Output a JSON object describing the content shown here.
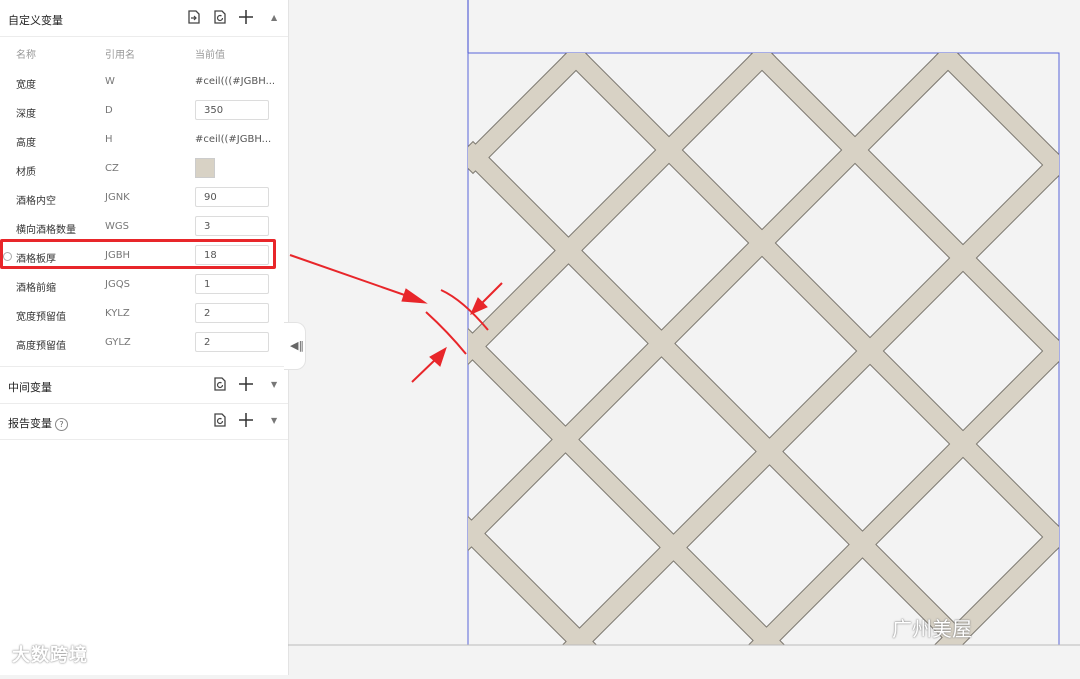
{
  "panel": {
    "custom_section": {
      "title": "自定义变量",
      "columns": {
        "name": "名称",
        "ref": "引用名",
        "value": "当前值"
      },
      "rows": [
        {
          "name": "宽度",
          "ref": "W",
          "value": "#ceil(((#JGBH...",
          "kind": "text"
        },
        {
          "name": "深度",
          "ref": "D",
          "value": "350",
          "kind": "input"
        },
        {
          "name": "高度",
          "ref": "H",
          "value": "#ceil((#JGBH...",
          "kind": "text"
        },
        {
          "name": "材质",
          "ref": "CZ",
          "value": "",
          "kind": "swatch",
          "color": "#d8d2c5"
        },
        {
          "name": "酒格内空",
          "ref": "JGNK",
          "value": "90",
          "kind": "input"
        },
        {
          "name": "横向酒格数量",
          "ref": "WGS",
          "value": "3",
          "kind": "input"
        },
        {
          "name": "酒格板厚",
          "ref": "JGBH",
          "value": "18",
          "kind": "input",
          "highlighted": true
        },
        {
          "name": "酒格前缩",
          "ref": "JGQS",
          "value": "1",
          "kind": "input"
        },
        {
          "name": "宽度预留值",
          "ref": "KYLZ",
          "value": "2",
          "kind": "input"
        },
        {
          "name": "高度预留值",
          "ref": "GYLZ",
          "value": "2",
          "kind": "input"
        }
      ]
    },
    "middle_section": {
      "title": "中间变量"
    },
    "report_section": {
      "title": "报告变量",
      "help": "?"
    }
  },
  "colors": {
    "highlight_red": "#e8262a",
    "panel_line": "#5a64d8",
    "wood": "#d8d2c5",
    "wood_edge": "#7a766e"
  },
  "watermarks": {
    "left": "大数跨境",
    "right": "广州美屋"
  }
}
